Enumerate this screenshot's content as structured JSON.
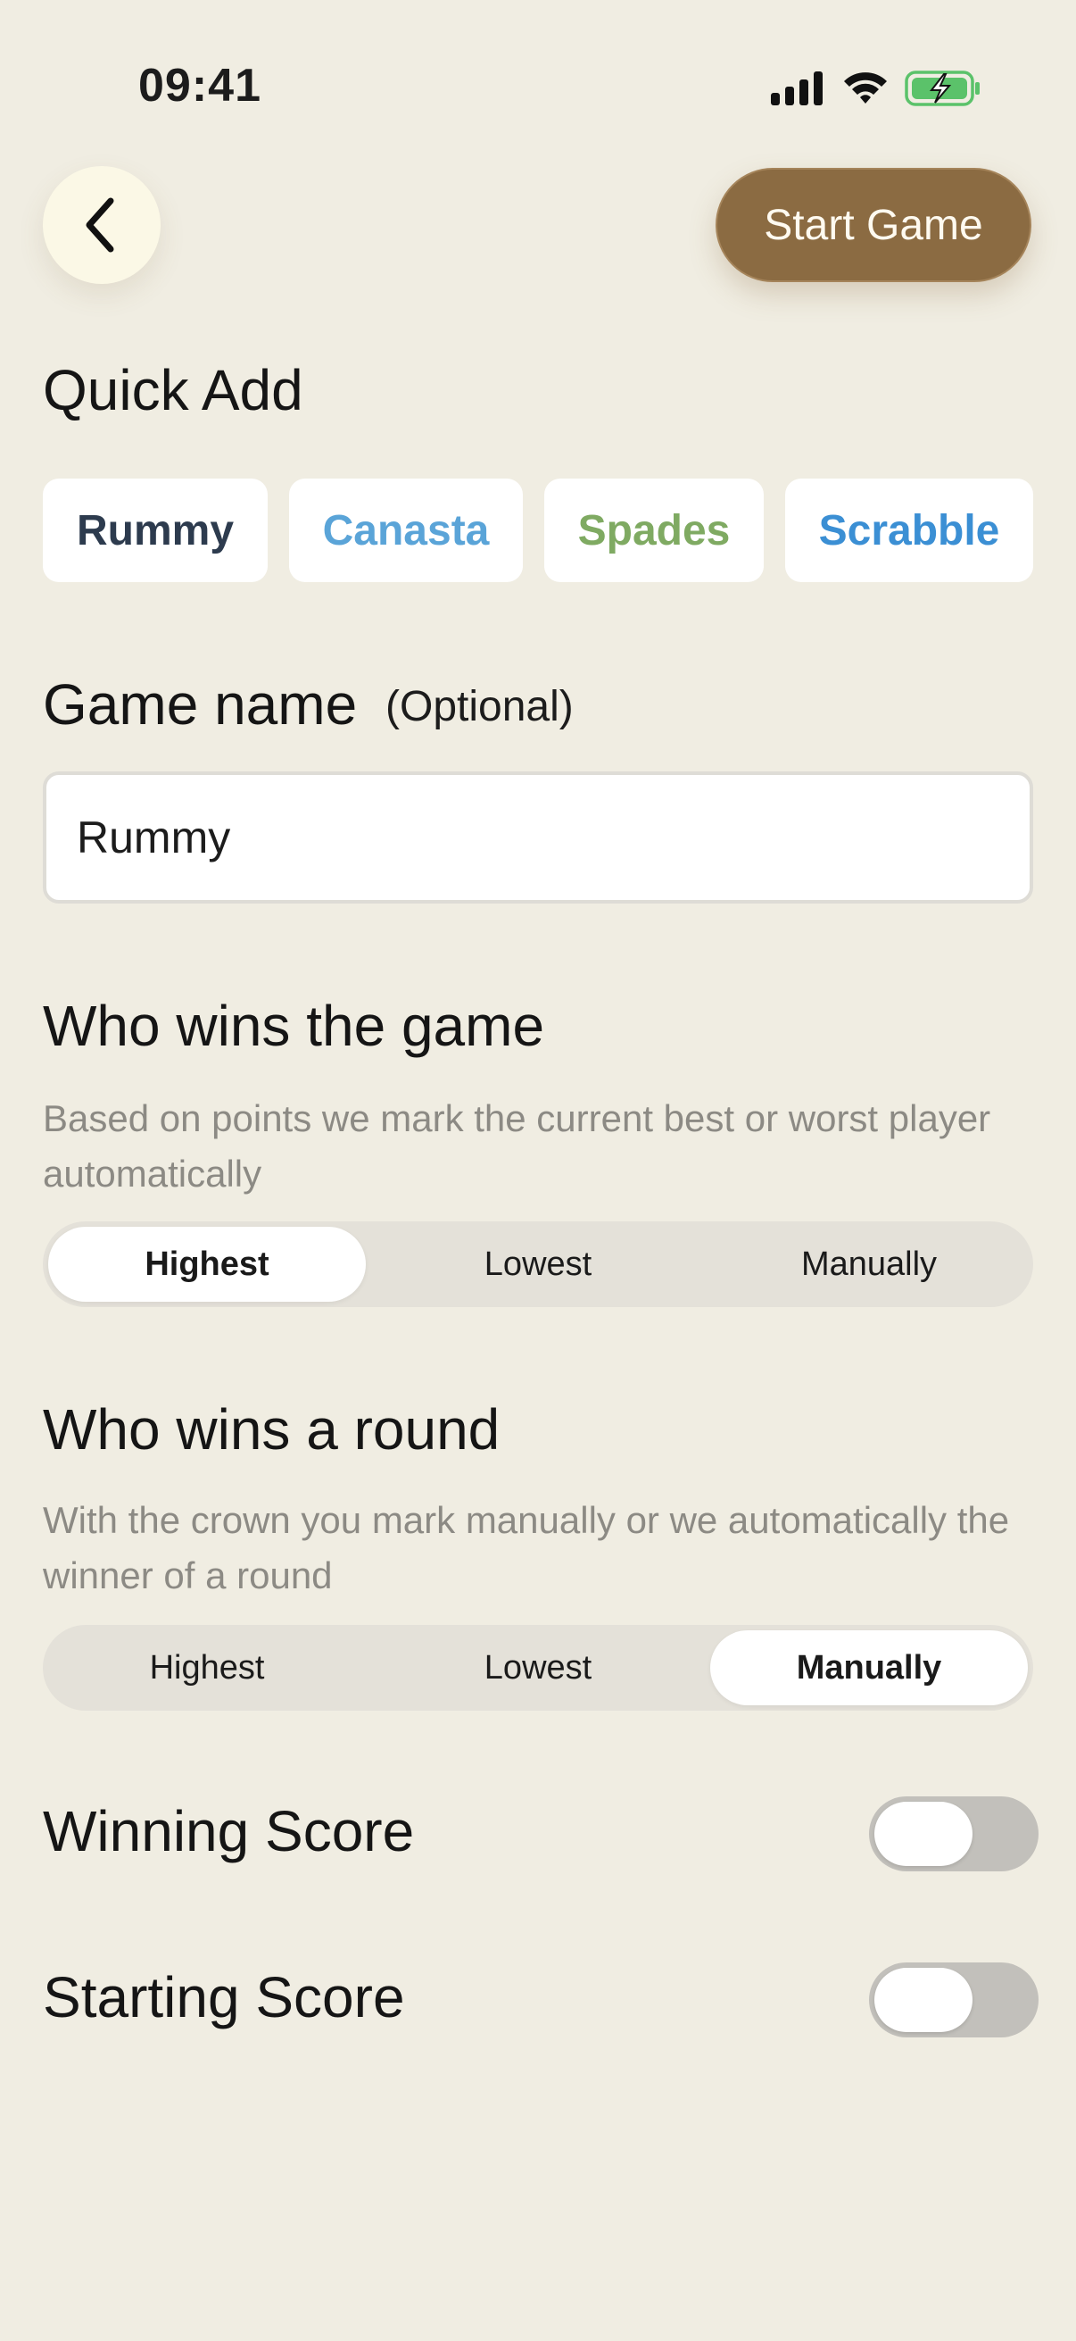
{
  "status_bar": {
    "time": "09:41"
  },
  "header": {
    "back_icon": "chevron-left-icon",
    "start_label": "Start Game"
  },
  "quick_add": {
    "title": "Quick Add",
    "chips": [
      {
        "label": "Rummy",
        "color": "#2d3b4e"
      },
      {
        "label": "Canasta",
        "color": "#5aa4d8"
      },
      {
        "label": "Spades",
        "color": "#7faa62"
      },
      {
        "label": "Scrabble",
        "color": "#3b8fd4"
      }
    ]
  },
  "game_name": {
    "title": "Game name",
    "optional": "(Optional)",
    "value": "Rummy"
  },
  "game_winner": {
    "title": "Who wins the game",
    "description": "Based on points we mark the current best or worst player automatically",
    "options": [
      "Highest",
      "Lowest",
      "Manually"
    ],
    "selected": "Highest"
  },
  "round_winner": {
    "title": "Who wins a round",
    "description": "With the crown you mark manually or we automatically the winner of a round",
    "options": [
      "Highest",
      "Lowest",
      "Manually"
    ],
    "selected": "Manually"
  },
  "winning_score": {
    "label": "Winning Score",
    "enabled": false
  },
  "starting_score": {
    "label": "Starting Score",
    "enabled": false
  },
  "colors": {
    "background": "#f0ede2",
    "accent": "#8b6b42"
  }
}
